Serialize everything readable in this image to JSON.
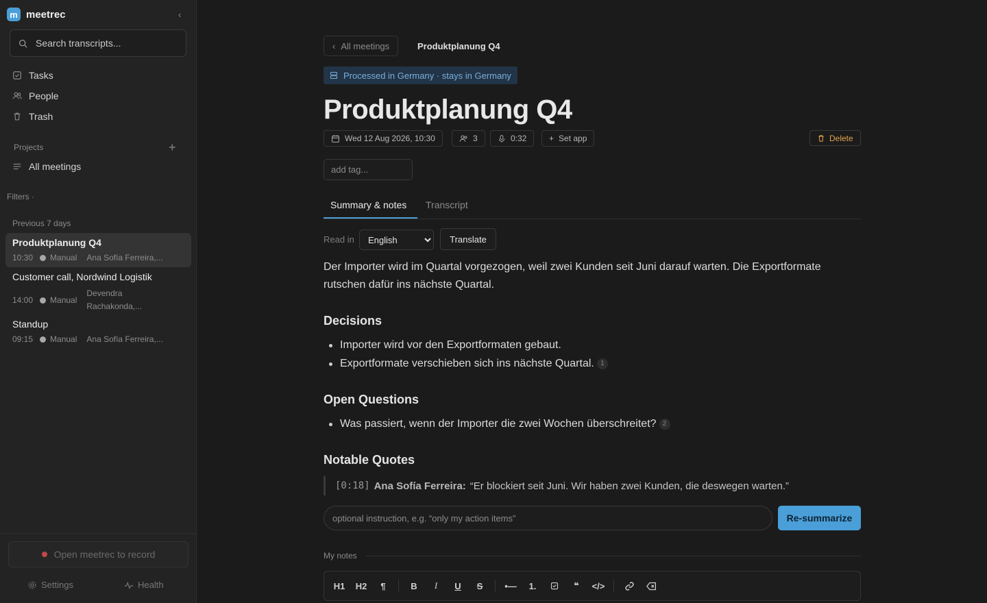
{
  "app": {
    "name": "meetrec",
    "logo_letter": "m"
  },
  "sidebar": {
    "search_placeholder": "Search transcripts...",
    "nav": [
      {
        "label": "Tasks",
        "icon": "checkbox-icon"
      },
      {
        "label": "People",
        "icon": "people-icon"
      },
      {
        "label": "Trash",
        "icon": "trash-icon"
      }
    ],
    "projects_label": "Projects",
    "all_meetings_label": "All meetings",
    "filters_label": "Filters ·",
    "group_label": "Previous 7 days",
    "meetings": [
      {
        "title": "Produktplanung Q4",
        "time": "10:30",
        "source": "Manual",
        "people": "Ana Sofía Ferreira,...",
        "active": true
      },
      {
        "title": "Customer call, Nordwind Logistik",
        "time": "14:00",
        "source": "Manual",
        "people_line1": "Devendra",
        "people_line2": "Rachakonda,...",
        "active": false
      },
      {
        "title": "Standup",
        "time": "09:15",
        "source": "Manual",
        "people": "Ana Sofía Ferreira,...",
        "active": false
      }
    ],
    "record_label": "Open meetrec to record",
    "settings_label": "Settings",
    "health_label": "Health"
  },
  "header": {
    "back_label": "All meetings",
    "breadcrumb_title": "Produktplanung Q4",
    "geo_badge": "Processed in Germany · stays in Germany",
    "title": "Produktplanung Q4",
    "date": "Wed 12 Aug 2026, 10:30",
    "participants": "3",
    "duration": "0:32",
    "set_app": "Set app",
    "delete": "Delete",
    "tag_placeholder": "add tag..."
  },
  "tabs": [
    {
      "label": "Summary & notes",
      "active": true
    },
    {
      "label": "Transcript",
      "active": false
    }
  ],
  "read_in": {
    "label": "Read in",
    "selected": "English",
    "translate_label": "Translate"
  },
  "summary": "Der Importer wird im Quartal vorgezogen, weil zwei Kunden seit Juni darauf warten. Die Exportformate rutschen dafür ins nächste Quartal.",
  "decisions": {
    "heading": "Decisions",
    "items": [
      {
        "text": "Importer wird vor den Exportformaten gebaut.",
        "ref": ""
      },
      {
        "text": "Exportformate verschieben sich ins nächste Quartal.",
        "ref": "1"
      }
    ]
  },
  "open_questions": {
    "heading": "Open Questions",
    "items": [
      {
        "text": "Was passiert, wenn der Importer die zwei Wochen überschreitet?",
        "ref": "2"
      }
    ]
  },
  "quotes": {
    "heading": "Notable Quotes",
    "items": [
      {
        "timestamp": "[0:18]",
        "speaker": "Ana Sofía Ferreira:",
        "text": "“Er blockiert seit Juni. Wir haben zwei Kunden, die deswegen warten.”"
      }
    ]
  },
  "resummarize": {
    "placeholder": "optional instruction, e.g. “only my action items”",
    "button": "Re-summarize"
  },
  "notes": {
    "label": "My notes",
    "toolbar": [
      "H1",
      "H2",
      "¶",
      "B",
      "I",
      "U",
      "S"
    ]
  },
  "colors": {
    "accent": "#4a9fd8",
    "delete": "#e3a34d",
    "record_dot": "#c0484a",
    "badge_bg": "#223447"
  }
}
